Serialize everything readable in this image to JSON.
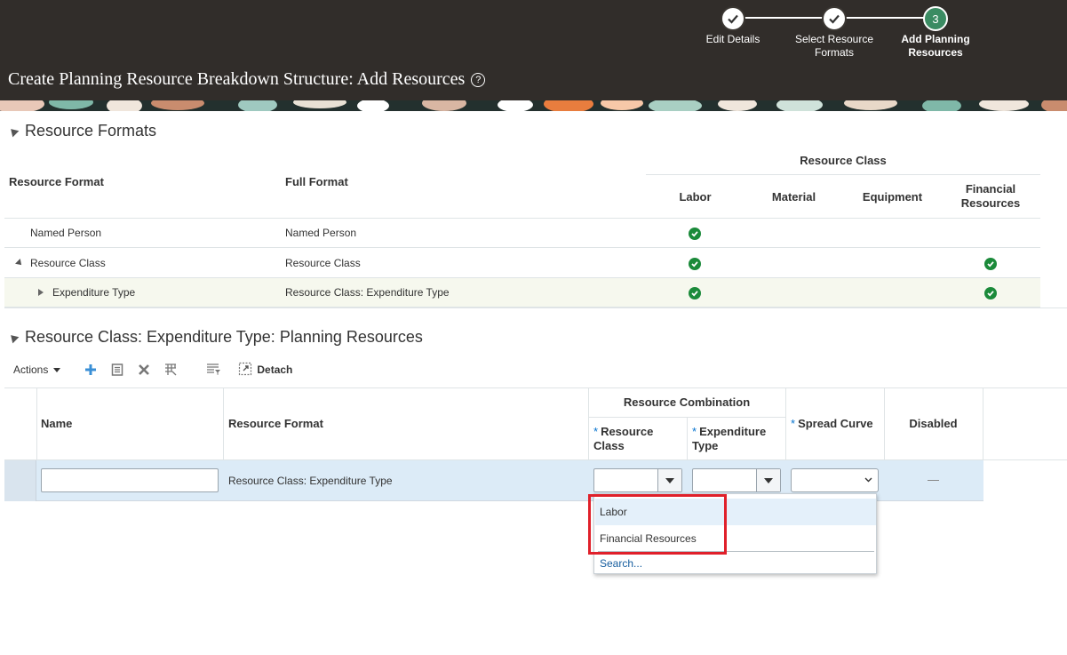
{
  "header": {
    "title": "Create Planning Resource Breakdown Structure: Add Resources",
    "help_icon": "question-circle-icon",
    "train": [
      {
        "label": "Edit Details",
        "state": "done",
        "icon": "check-icon"
      },
      {
        "label": "Select Resource Formats",
        "state": "done",
        "icon": "check-icon"
      },
      {
        "label": "Add Planning Resources",
        "state": "current",
        "number": "3"
      }
    ]
  },
  "resource_formats": {
    "heading": "Resource Formats",
    "columns": {
      "resource_format": "Resource Format",
      "full_format": "Full Format",
      "resource_class_group": "Resource Class",
      "labor": "Labor",
      "material": "Material",
      "equipment": "Equipment",
      "financial": "Financial Resources"
    },
    "rows": [
      {
        "format": "Named Person",
        "full": "Resource Class",
        "full_text": "Named Person",
        "labor": true,
        "material": false,
        "equipment": false,
        "financial": false
      },
      {
        "format": "Resource Class",
        "full_text": "Resource Class",
        "labor": true,
        "material": false,
        "equipment": false,
        "financial": true
      },
      {
        "format": "Expenditure Type",
        "full_text": "Resource Class: Expenditure Type",
        "labor": true,
        "material": false,
        "equipment": false,
        "financial": true
      }
    ]
  },
  "planning_resources": {
    "heading": "Resource Class: Expenditure Type: Planning Resources",
    "toolbar": {
      "actions_label": "Actions",
      "add_icon": "plus-icon",
      "edit_icon": "document-icon",
      "delete_icon": "x-icon",
      "freeze_icon": "freeze-columns-icon",
      "query_icon": "query-by-example-icon",
      "detach_icon": "detach-icon",
      "detach_label": "Detach"
    },
    "columns": {
      "name": "Name",
      "resource_format": "Resource Format",
      "resource_combination": "Resource Combination",
      "resource_class": "Resource Class",
      "expenditure_type": "Expenditure Type",
      "spread_curve": "Spread Curve",
      "disabled": "Disabled",
      "required_marker": "*"
    },
    "row": {
      "name_value": "",
      "resource_format": "Resource Class: Expenditure Type",
      "resource_class_value": "",
      "expenditure_type_value": "",
      "spread_curve_value": ""
    },
    "dropdown": {
      "options": [
        "Labor",
        "Financial Resources"
      ],
      "search_label": "Search..."
    }
  },
  "colors": {
    "header_bg": "#312d2a",
    "train_current": "#3b8c63",
    "check_green": "#1b8a3a",
    "highlight_red": "#e0202a",
    "row_selected": "#dcebf7"
  }
}
